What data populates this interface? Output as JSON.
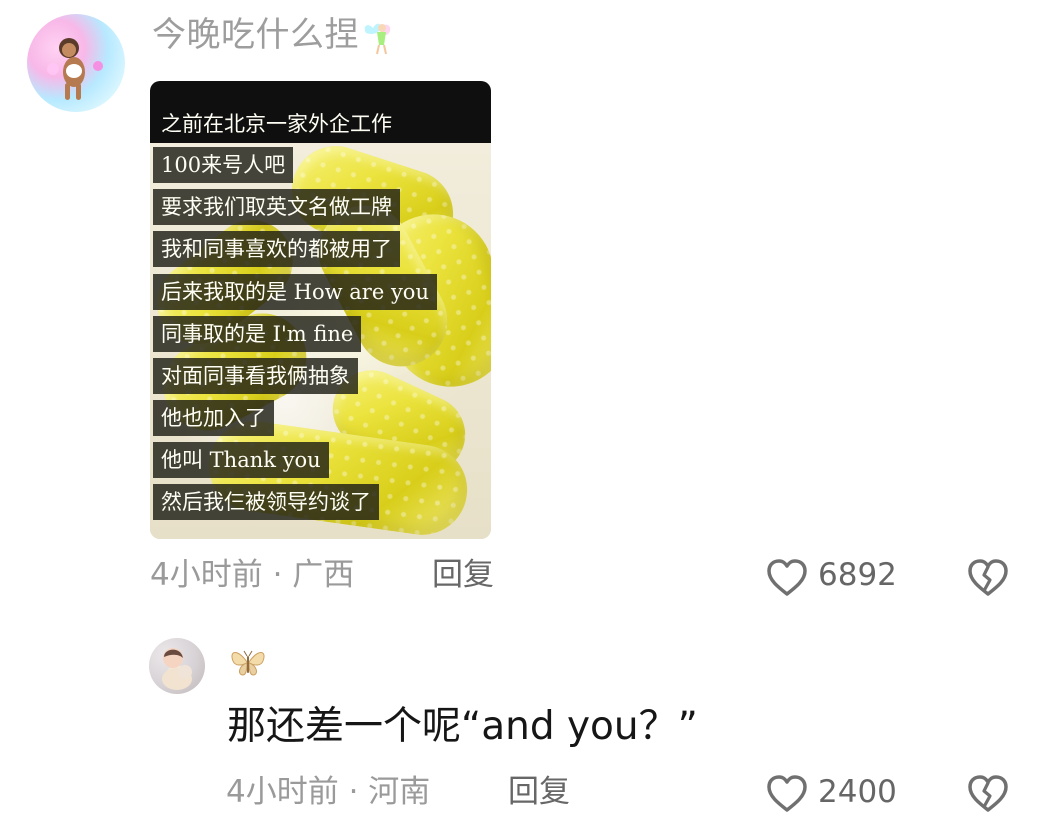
{
  "top_comment": {
    "username": "今晚吃什么捏",
    "image_captions": [
      "之前在北京一家外企工作",
      "100来号人吧",
      "要求我们取英文名做工牌",
      "我和同事喜欢的都被用了",
      "后来我取的是 How are you",
      "同事取的是 I'm fine",
      "对面同事看我俩抽象",
      "他也加入了",
      "他叫 Thank you",
      "然后我仨被领导约谈了"
    ],
    "meta": "4小时前 · 广西",
    "reply_label": "回复",
    "like_count": "6892"
  },
  "reply_comment": {
    "text": "那还差一个呢“and you？”",
    "meta": "4小时前 · 河南",
    "reply_label": "回复",
    "like_count": "2400"
  },
  "icons": {
    "username_decoration_1": "fairy-icon",
    "username_decoration_2": "butterfly-icon",
    "like": "heart-outline-icon",
    "dislike": "broken-heart-icon"
  },
  "colors": {
    "background": "#ffffff",
    "meta_text": "#9a9a9a",
    "reply_text": "#676767",
    "icon_gray": "#707070",
    "caption_bg": "#1e1e16"
  }
}
